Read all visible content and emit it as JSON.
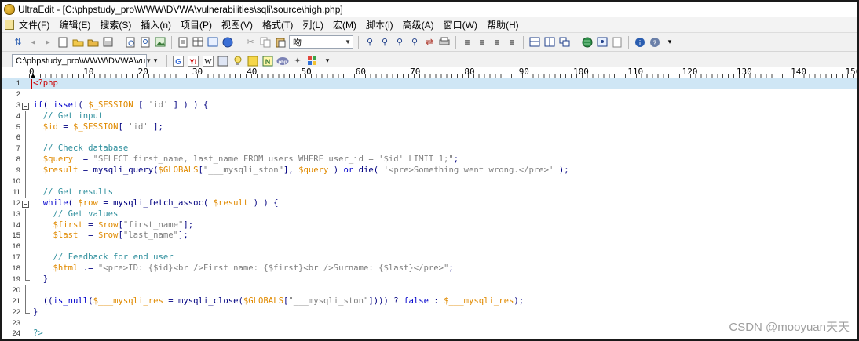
{
  "window": {
    "title": "UltraEdit - [C:\\phpstudy_pro\\WWW\\DVWA\\vulnerabilities\\sqli\\source\\high.php]"
  },
  "menu": [
    "文件(F)",
    "编辑(E)",
    "搜索(S)",
    "插入(n)",
    "项目(P)",
    "视图(V)",
    "格式(T)",
    "列(L)",
    "宏(M)",
    "脚本(i)",
    "高级(A)",
    "窗口(W)",
    "帮助(H)"
  ],
  "toolbar1": {
    "font_combo": "吻"
  },
  "toolbar2": {
    "path_combo": "C:\\phpstudy_pro\\WWW\\DVWA\\vu"
  },
  "ruler": {
    "labels": [
      "0",
      "10",
      "20",
      "30",
      "40",
      "50",
      "60",
      "70",
      "80",
      "90",
      "100",
      "110",
      "120",
      "130",
      "140",
      "150"
    ]
  },
  "colors": {
    "comment": "#2f8f9d",
    "keyword": "#0000cc",
    "variable": "#e08a00",
    "string": "#808080",
    "default": "#000080",
    "php_tag": "#cc0000"
  },
  "code": [
    {
      "n": "1",
      "fold": "none",
      "tokens": [
        [
          "tag",
          "<?php"
        ]
      ]
    },
    {
      "n": "2",
      "fold": "none",
      "tokens": []
    },
    {
      "n": "3",
      "fold": "open",
      "tokens": [
        [
          "kw",
          "if"
        ],
        [
          "def",
          "( "
        ],
        [
          "kw",
          "isset"
        ],
        [
          "def",
          "( "
        ],
        [
          "var",
          "$_SESSION"
        ],
        [
          "def",
          " [ "
        ],
        [
          "str",
          "'id'"
        ],
        [
          "def",
          " ] ) ) {"
        ]
      ]
    },
    {
      "n": "4",
      "fold": "line",
      "tokens": [
        [
          "def",
          "  "
        ],
        [
          "cm",
          "// Get input"
        ]
      ]
    },
    {
      "n": "5",
      "fold": "line",
      "tokens": [
        [
          "def",
          "  "
        ],
        [
          "var",
          "$id"
        ],
        [
          "def",
          " = "
        ],
        [
          "var",
          "$_SESSION"
        ],
        [
          "def",
          "[ "
        ],
        [
          "str",
          "'id'"
        ],
        [
          "def",
          " ];"
        ]
      ]
    },
    {
      "n": "6",
      "fold": "line",
      "tokens": []
    },
    {
      "n": "7",
      "fold": "line",
      "tokens": [
        [
          "def",
          "  "
        ],
        [
          "cm",
          "// Check database"
        ]
      ]
    },
    {
      "n": "8",
      "fold": "line",
      "tokens": [
        [
          "def",
          "  "
        ],
        [
          "var",
          "$query"
        ],
        [
          "def",
          "  = "
        ],
        [
          "str",
          "\"SELECT first_name, last_name FROM users WHERE user_id = '$id' LIMIT 1;\""
        ],
        [
          "def",
          ";"
        ]
      ]
    },
    {
      "n": "9",
      "fold": "line",
      "tokens": [
        [
          "def",
          "  "
        ],
        [
          "var",
          "$result"
        ],
        [
          "def",
          " = mysqli_query("
        ],
        [
          "var",
          "$GLOBALS"
        ],
        [
          "def",
          "["
        ],
        [
          "str",
          "\"___mysqli_ston\""
        ],
        [
          "def",
          "], "
        ],
        [
          "var",
          "$query"
        ],
        [
          "def",
          " ) "
        ],
        [
          "kw",
          "or"
        ],
        [
          "def",
          " die( "
        ],
        [
          "str",
          "'<pre>Something went wrong.</pre>'"
        ],
        [
          "def",
          " );"
        ]
      ]
    },
    {
      "n": "10",
      "fold": "line",
      "tokens": []
    },
    {
      "n": "11",
      "fold": "line",
      "tokens": [
        [
          "def",
          "  "
        ],
        [
          "cm",
          "// Get results"
        ]
      ]
    },
    {
      "n": "12",
      "fold": "open",
      "tokens": [
        [
          "def",
          "  "
        ],
        [
          "kw",
          "while"
        ],
        [
          "def",
          "( "
        ],
        [
          "var",
          "$row"
        ],
        [
          "def",
          " = mysqli_fetch_assoc( "
        ],
        [
          "var",
          "$result"
        ],
        [
          "def",
          " ) ) {"
        ]
      ]
    },
    {
      "n": "13",
      "fold": "line",
      "tokens": [
        [
          "def",
          "    "
        ],
        [
          "cm",
          "// Get values"
        ]
      ]
    },
    {
      "n": "14",
      "fold": "line",
      "tokens": [
        [
          "def",
          "    "
        ],
        [
          "var",
          "$first"
        ],
        [
          "def",
          " = "
        ],
        [
          "var",
          "$row"
        ],
        [
          "def",
          "["
        ],
        [
          "str",
          "\"first_name\""
        ],
        [
          "def",
          "];"
        ]
      ]
    },
    {
      "n": "15",
      "fold": "line",
      "tokens": [
        [
          "def",
          "    "
        ],
        [
          "var",
          "$last"
        ],
        [
          "def",
          "  = "
        ],
        [
          "var",
          "$row"
        ],
        [
          "def",
          "["
        ],
        [
          "str",
          "\"last_name\""
        ],
        [
          "def",
          "];"
        ]
      ]
    },
    {
      "n": "16",
      "fold": "line",
      "tokens": []
    },
    {
      "n": "17",
      "fold": "line",
      "tokens": [
        [
          "def",
          "    "
        ],
        [
          "cm",
          "// Feedback for end user"
        ]
      ]
    },
    {
      "n": "18",
      "fold": "line",
      "tokens": [
        [
          "def",
          "    "
        ],
        [
          "var",
          "$html"
        ],
        [
          "def",
          " .= "
        ],
        [
          "str",
          "\"<pre>ID: {$id}<br />First name: {$first}<br />Surname: {$last}</pre>\""
        ],
        [
          "def",
          ";"
        ]
      ]
    },
    {
      "n": "19",
      "fold": "end",
      "tokens": [
        [
          "def",
          "  }"
        ]
      ]
    },
    {
      "n": "20",
      "fold": "line",
      "tokens": []
    },
    {
      "n": "21",
      "fold": "line",
      "tokens": [
        [
          "def",
          "  (("
        ],
        [
          "kw",
          "is_null"
        ],
        [
          "def",
          "("
        ],
        [
          "var",
          "$___mysqli_res"
        ],
        [
          "def",
          " = mysqli_close("
        ],
        [
          "var",
          "$GLOBALS"
        ],
        [
          "def",
          "["
        ],
        [
          "str",
          "\"___mysqli_ston\""
        ],
        [
          "def",
          "]))) ? "
        ],
        [
          "kw",
          "false"
        ],
        [
          "def",
          " : "
        ],
        [
          "var",
          "$___mysqli_res"
        ],
        [
          "def",
          ");"
        ]
      ]
    },
    {
      "n": "22",
      "fold": "end",
      "tokens": [
        [
          "def",
          "}"
        ]
      ]
    },
    {
      "n": "23",
      "fold": "none",
      "tokens": []
    },
    {
      "n": "24",
      "fold": "none",
      "tokens": [
        [
          "tagend",
          "?>"
        ]
      ]
    }
  ],
  "watermark": "CSDN @mooyuan天天"
}
